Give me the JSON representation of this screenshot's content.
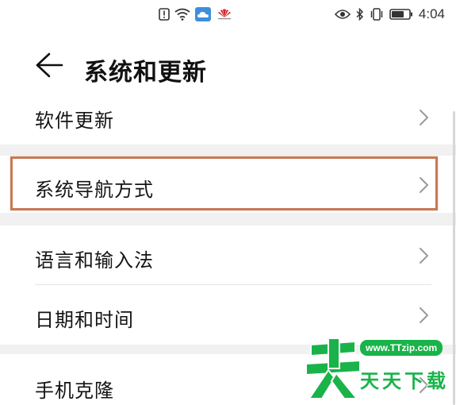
{
  "status_bar": {
    "time": "4:04",
    "icons_left": [
      "alert-icon",
      "wifi-icon",
      "cloud-icon",
      "huawei-logo"
    ],
    "icons_right": [
      "eye-icon",
      "bluetooth-icon",
      "vibrate-icon",
      "battery-icon"
    ]
  },
  "header": {
    "title": "系统和更新",
    "back_icon": "back-arrow-icon"
  },
  "menu": {
    "items": [
      {
        "label": "软件更新"
      },
      {
        "label": "系统导航方式"
      },
      {
        "label": "语言和输入法"
      },
      {
        "label": "日期和时间"
      },
      {
        "label": "手机克隆"
      }
    ]
  },
  "highlight": {
    "color": "#c77a56"
  },
  "watermark": {
    "url": "www.TTzip.com",
    "brand": "天天下载",
    "color": "#19b34a"
  }
}
